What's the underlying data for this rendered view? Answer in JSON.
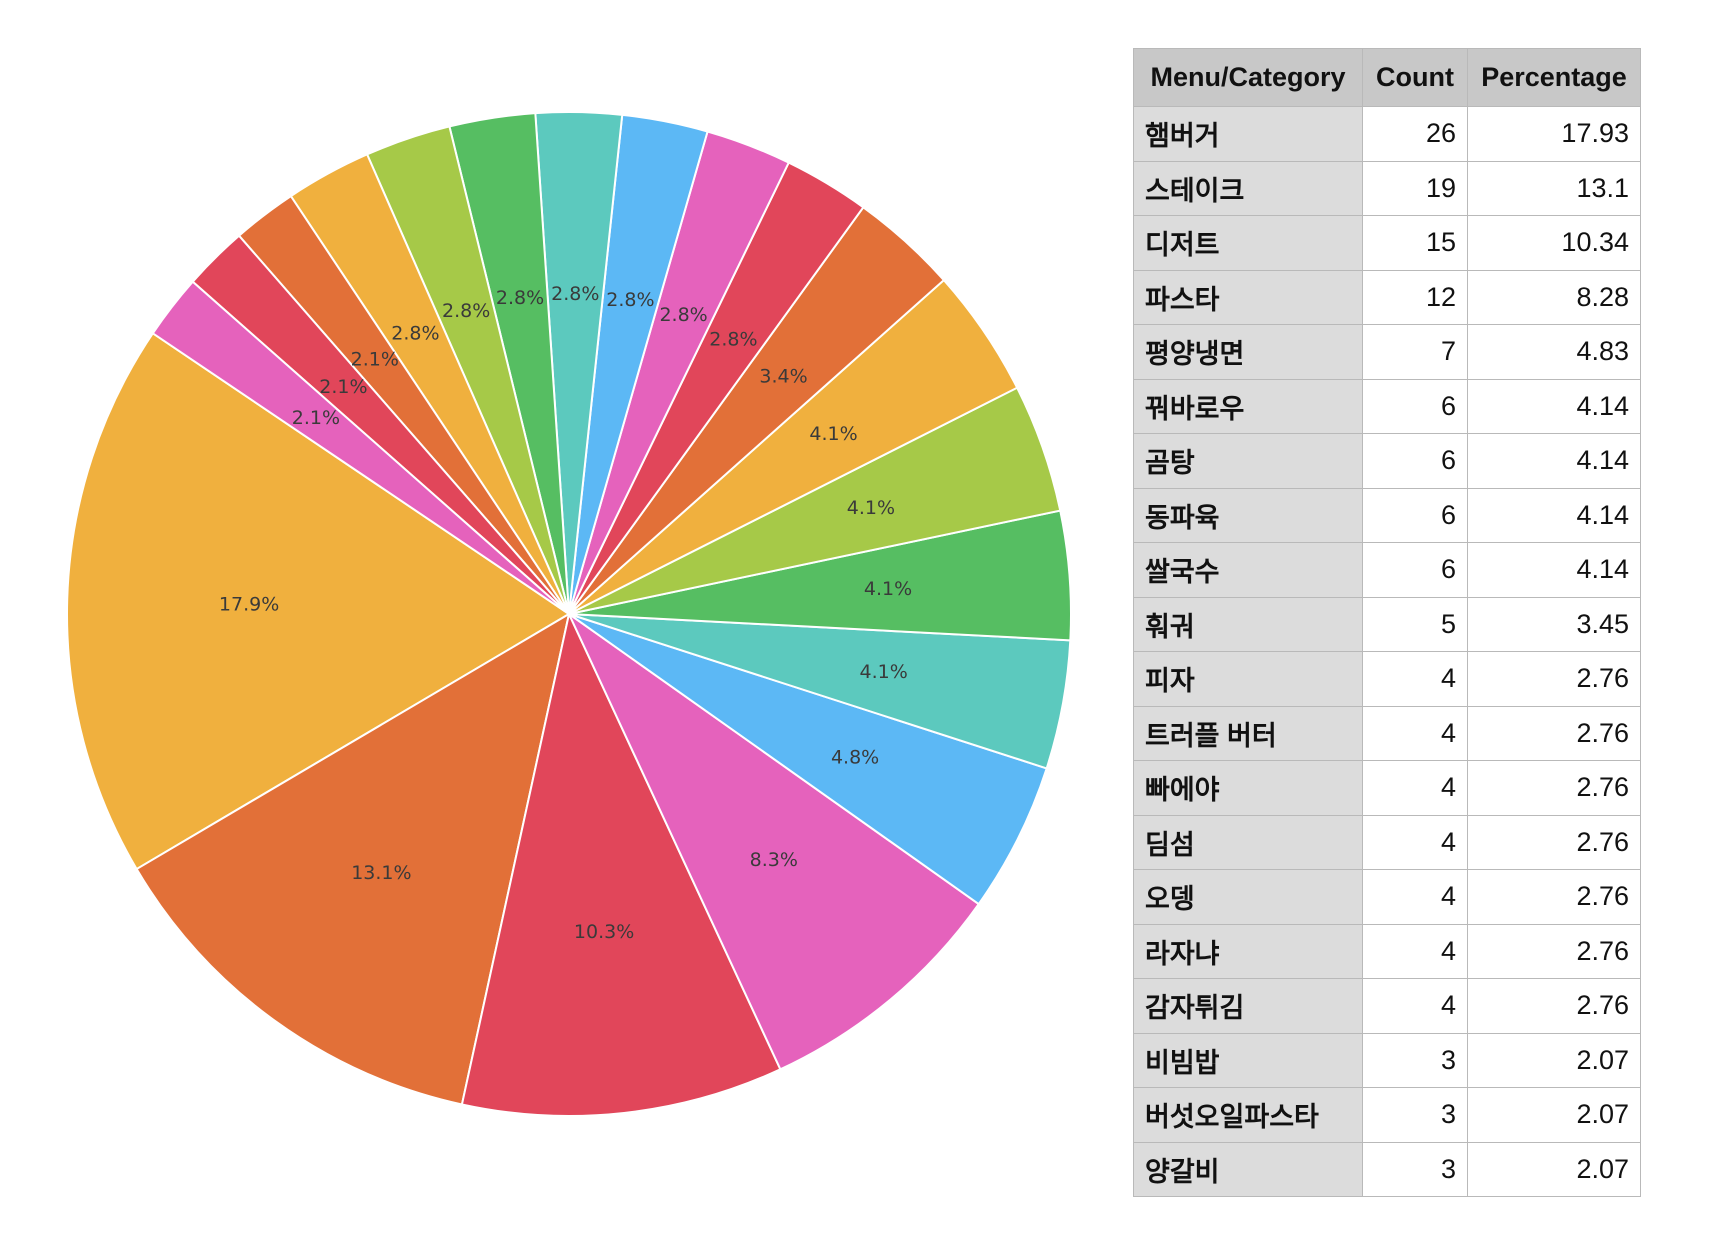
{
  "chart_data": {
    "type": "pie",
    "labels_shown": [
      "17.9%",
      "13.1%",
      "10.3%",
      "8.3%",
      "4.8%",
      "4.1%",
      "4.1%",
      "4.1%",
      "4.1%",
      "3.4%",
      "2.8%",
      "2.8%",
      "2.8%",
      "2.8%",
      "2.8%",
      "2.8%",
      "2.8%",
      "2.1%",
      "2.1%",
      "2.1%"
    ],
    "values": [
      17.93,
      13.1,
      10.34,
      8.28,
      4.83,
      4.14,
      4.14,
      4.14,
      4.14,
      3.45,
      2.76,
      2.76,
      2.76,
      2.76,
      2.76,
      2.76,
      2.76,
      2.07,
      2.07,
      2.07
    ],
    "colors": [
      "#f0b03e",
      "#e27038",
      "#e1465a",
      "#e562bc",
      "#5cb8f5",
      "#5cc9be",
      "#56be62",
      "#a6c948",
      "#f0b03e",
      "#e27038",
      "#e1465a",
      "#e562bc",
      "#5cb8f5",
      "#5cc9be",
      "#56be62",
      "#a6c948",
      "#f0b03e",
      "#e27038",
      "#e1465a",
      "#e562bc"
    ],
    "start_angle_deg": 146,
    "direction": "counterclockwise"
  },
  "table": {
    "headers": [
      "Menu/Category",
      "Count",
      "Percentage"
    ],
    "rows": [
      [
        "햄버거",
        "26",
        "17.93"
      ],
      [
        "스테이크",
        "19",
        "13.1"
      ],
      [
        "디저트",
        "15",
        "10.34"
      ],
      [
        "파스타",
        "12",
        "8.28"
      ],
      [
        "평양냉면",
        "7",
        "4.83"
      ],
      [
        "꿔바로우",
        "6",
        "4.14"
      ],
      [
        "곰탕",
        "6",
        "4.14"
      ],
      [
        "동파육",
        "6",
        "4.14"
      ],
      [
        "쌀국수",
        "6",
        "4.14"
      ],
      [
        "훠궈",
        "5",
        "3.45"
      ],
      [
        "피자",
        "4",
        "2.76"
      ],
      [
        "트러플 버터",
        "4",
        "2.76"
      ],
      [
        "빠에야",
        "4",
        "2.76"
      ],
      [
        "딤섬",
        "4",
        "2.76"
      ],
      [
        "오뎅",
        "4",
        "2.76"
      ],
      [
        "라자냐",
        "4",
        "2.76"
      ],
      [
        "감자튀김",
        "4",
        "2.76"
      ],
      [
        "비빔밥",
        "3",
        "2.07"
      ],
      [
        "버섯오일파스타",
        "3",
        "2.07"
      ],
      [
        "양갈비",
        "3",
        "2.07"
      ]
    ]
  }
}
